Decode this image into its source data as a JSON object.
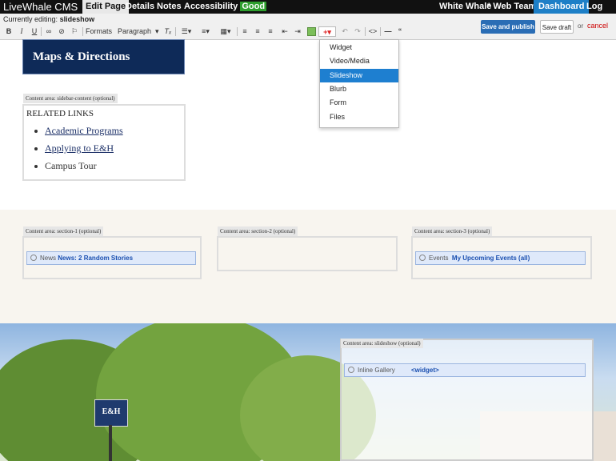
{
  "topbar": {
    "brand": "LiveWhale CMS",
    "tabs": [
      "Edit Page",
      "Details",
      "Notes",
      "Accessibility"
    ],
    "accessibility_status": "Good",
    "right": {
      "site": "White Whale",
      "group": "* Web Team",
      "dashboard": "Dashboard",
      "logout": "Log out"
    }
  },
  "toolbar": {
    "editing_label": "Currently editing:",
    "editing_value": "slideshow",
    "formats": "Formats",
    "paragraph": "Paragraph",
    "save_publish": "Save and publish",
    "save_draft": "Save draft",
    "or": "or",
    "cancel": "cancel"
  },
  "insert_menu": {
    "items": [
      "Widget",
      "Video/Media",
      "Slideshow",
      "Blurb",
      "Form",
      "Files"
    ],
    "selected": "Slideshow"
  },
  "content": {
    "maps_heading": "Maps & Directions",
    "sidebar_label": "Content area: sidebar-content (optional)",
    "related_title": "RELATED LINKS",
    "related_links": [
      {
        "label": "Academic Programs",
        "link": true
      },
      {
        "label": "Applying to E&H",
        "link": true
      },
      {
        "label": "Campus Tour",
        "link": false
      }
    ],
    "sections": [
      {
        "label": "Content area: section-1 (optional)",
        "widget_type": "News",
        "widget_name": "News: 2 Random Stories"
      },
      {
        "label": "Content area: section-2 (optional)"
      },
      {
        "label": "Content area: section-3 (optional)",
        "widget_type": "Events",
        "widget_name": "My Upcoming Events (all)"
      }
    ],
    "slideshow": {
      "label": "Content area: slideshow (optional)",
      "widget_type": "Inline Gallery",
      "widget_name": "<widget>"
    },
    "sign_text": "E&H"
  },
  "colors": {
    "dashboard": "#1d7fc7",
    "primary_button": "#2a6db5",
    "selected_item": "#1e7fd0",
    "heading_bg": "#0e2a58",
    "link": "#1a4fb0"
  }
}
